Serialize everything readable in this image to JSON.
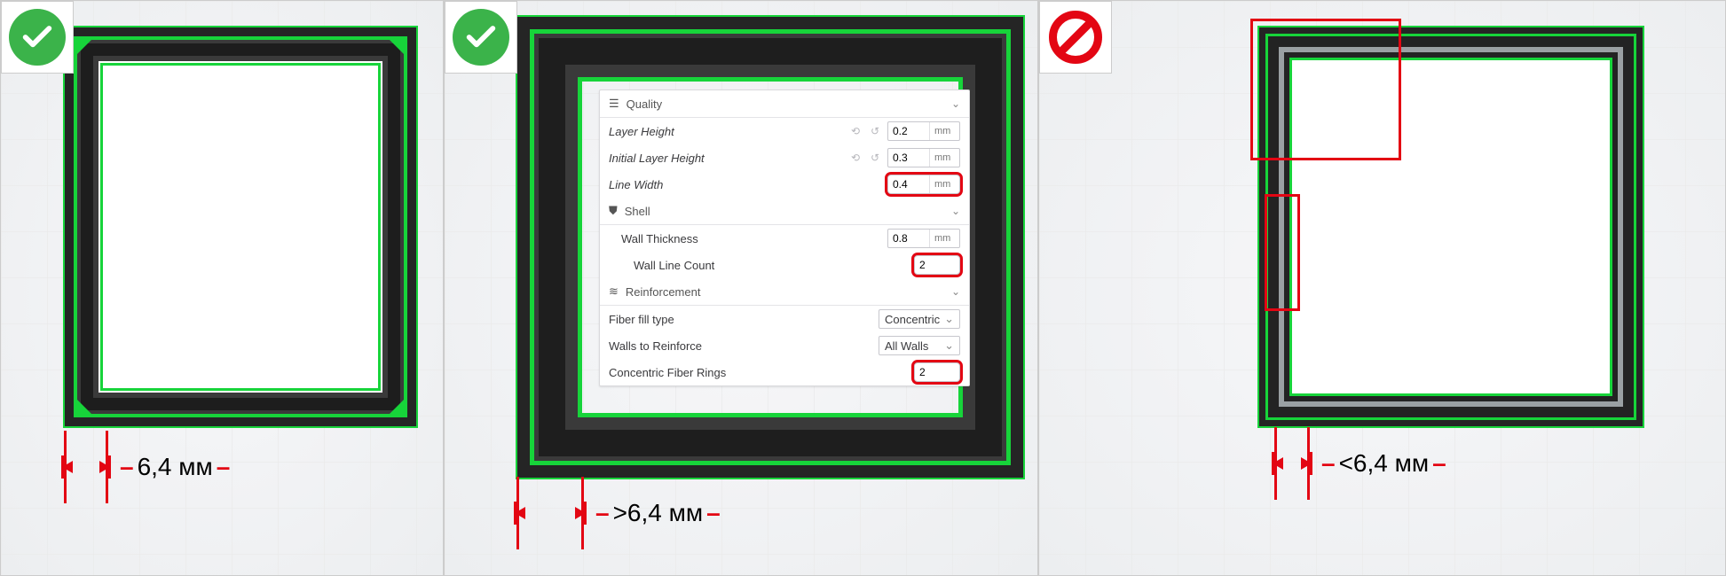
{
  "badges": {
    "ok": "ok",
    "no": "no"
  },
  "dimensions": {
    "p1": "6,4 мм",
    "p2": ">6,4 мм",
    "p3": "<6,4 мм"
  },
  "settings": {
    "quality": {
      "title": "Quality",
      "layer_height": {
        "label": "Layer Height",
        "value": "0.2",
        "unit": "mm"
      },
      "initial_layer_height": {
        "label": "Initial Layer Height",
        "value": "0.3",
        "unit": "mm"
      },
      "line_width": {
        "label": "Line Width",
        "value": "0.4",
        "unit": "mm"
      }
    },
    "shell": {
      "title": "Shell",
      "wall_thickness": {
        "label": "Wall Thickness",
        "value": "0.8",
        "unit": "mm"
      },
      "wall_line_count": {
        "label": "Wall Line Count",
        "value": "2"
      }
    },
    "reinforcement": {
      "title": "Reinforcement",
      "fiber_fill_type": {
        "label": "Fiber fill type",
        "value": "Concentric"
      },
      "walls_to_reinforce": {
        "label": "Walls to Reinforce",
        "value": "All Walls"
      },
      "concentric_fiber_rings": {
        "label": "Concentric Fiber Rings",
        "value": "2"
      }
    }
  }
}
